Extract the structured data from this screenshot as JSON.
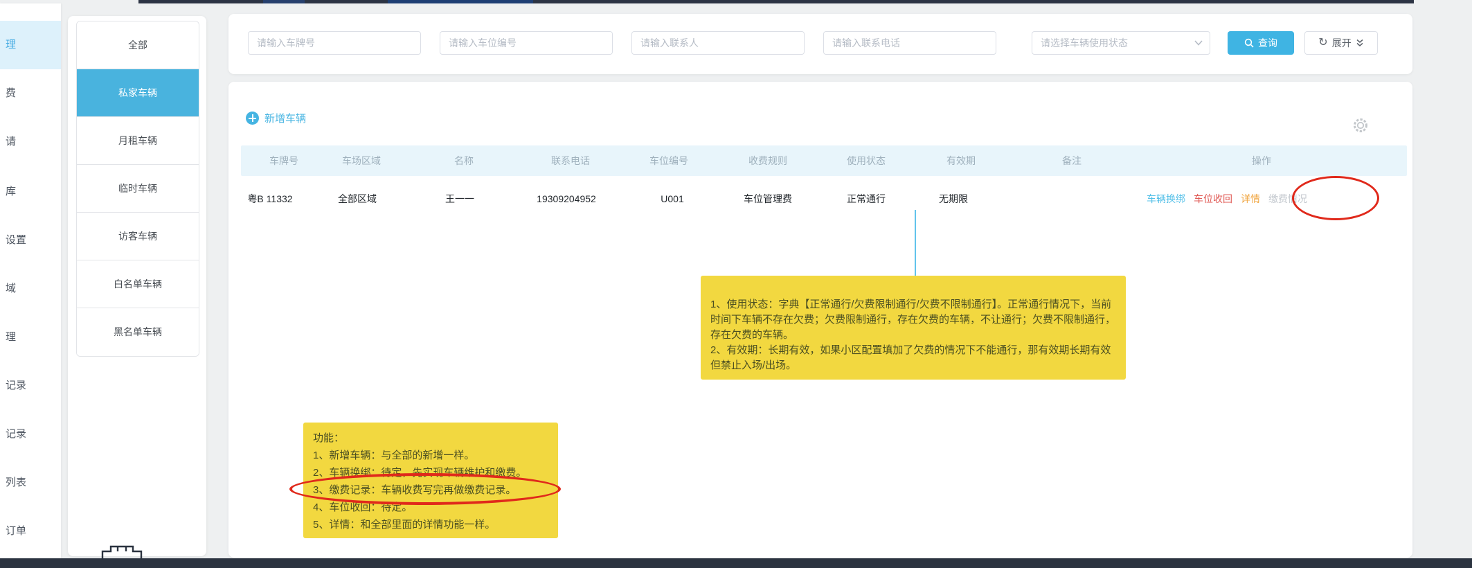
{
  "sidebar": {
    "items": [
      {
        "label": "理",
        "selected": true
      },
      {
        "label": "费",
        "selected": false
      },
      {
        "label": "请",
        "selected": false
      },
      {
        "label": "库",
        "selected": false
      },
      {
        "label": "设置",
        "selected": false
      },
      {
        "label": "域",
        "selected": false
      },
      {
        "label": "理",
        "selected": false
      },
      {
        "label": "记录",
        "selected": false
      },
      {
        "label": "记录",
        "selected": false
      },
      {
        "label": "列表",
        "selected": false
      },
      {
        "label": "订单",
        "selected": false
      }
    ]
  },
  "tabs": {
    "items": [
      {
        "label": "全部",
        "selected": false
      },
      {
        "label": "私家车辆",
        "selected": true
      },
      {
        "label": "月租车辆",
        "selected": false
      },
      {
        "label": "临时车辆",
        "selected": false
      },
      {
        "label": "访客车辆",
        "selected": false
      },
      {
        "label": "白名单车辆",
        "selected": false
      },
      {
        "label": "黑名单车辆",
        "selected": false
      }
    ]
  },
  "filters": {
    "inputs": [
      {
        "placeholder": "请输入车牌号",
        "value": ""
      },
      {
        "placeholder": "请输入车位编号",
        "value": ""
      },
      {
        "placeholder": "请输入联系人",
        "value": ""
      },
      {
        "placeholder": "请输入联系电话",
        "value": ""
      }
    ],
    "select": {
      "placeholder": "请选择车辆使用状态"
    },
    "search_label": "查询",
    "expand_label": "展开"
  },
  "toolbar": {
    "add_label": "新增车辆"
  },
  "table": {
    "headers": [
      "车牌号",
      "车场区域",
      "名称",
      "联系电话",
      "车位编号",
      "收费规则",
      "使用状态",
      "有效期",
      "备注",
      "操作"
    ],
    "row": {
      "plate": "粤B 11332",
      "area": "全部区域",
      "name": "王一一",
      "phone": "19309204952",
      "space_no": "U001",
      "fee_rule": "车位管理费",
      "status": "正常通行",
      "validity": "无期限",
      "remark": "",
      "actions": [
        {
          "label": "车辆换绑"
        },
        {
          "label": "车位收回"
        },
        {
          "label": "详情"
        },
        {
          "label": "缴费情况"
        }
      ]
    }
  },
  "notes": {
    "status_note": "1、使用状态：字典【正常通行/欠费限制通行/欠费不限制通行】。正常通行情况下，当前时间下车辆不存在欠费；欠费限制通行，存在欠费的车辆，不让通行；欠费不限制通行，存在欠费的车辆。\n2、有效期：长期有效，如果小区配置填加了欠费的情况下不能通行，那有效期长期有效但禁止入场/出场。",
    "feature_title": "功能：",
    "feature_items": [
      "1、新增车辆：与全部的新增一样。",
      "2、车辆换绑：待定，先实现车辆维护和缴费。",
      "3、缴费记录：车辆收费写完再做缴费记录。",
      "4、车位收回：待定。",
      "5、详情：和全部里面的详情功能一样。"
    ]
  },
  "colors": {
    "accent_blue": "#3fb4e3",
    "tab_selected": "#49b3de",
    "table_header_bg": "#e8f5fb",
    "note_yellow": "#f2d840",
    "annotation_red": "#e0291b",
    "connector_blue": "#62c4ec",
    "action_rebind": "#54c0e8",
    "action_reclaim": "#e05a55",
    "action_detail": "#f0a53f",
    "action_payment_disabled": "#c4c9cf",
    "bottom_bar": "#2b3340"
  }
}
